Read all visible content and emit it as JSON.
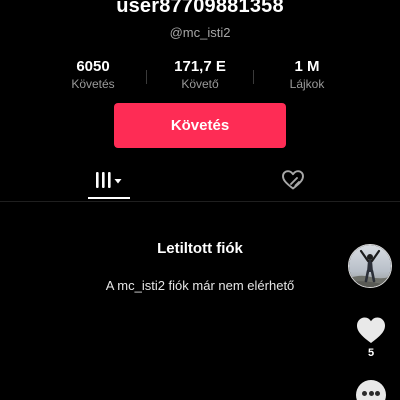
{
  "profile": {
    "username": "user87709881358",
    "handle": "@mc_isti2"
  },
  "stats": [
    {
      "value": "6050",
      "label": "Követés"
    },
    {
      "value": "171,7 E",
      "label": "Követő"
    },
    {
      "value": "1 M",
      "label": "Lájkok"
    }
  ],
  "actions": {
    "follow_label": "Követés",
    "follow_color": "#fe2c55"
  },
  "tabs": [
    {
      "icon": "grid-columns-icon",
      "active": true,
      "has_dropdown": true
    },
    {
      "icon": "liked-heart-icon",
      "active": false
    }
  ],
  "content": {
    "blocked_title": "Letiltott fiók",
    "blocked_description": "A mc_isti2 fiók már nem elérhető"
  },
  "side_actions": {
    "like_count": "5",
    "icons": [
      "avatar",
      "heart-icon",
      "more-icon"
    ]
  }
}
